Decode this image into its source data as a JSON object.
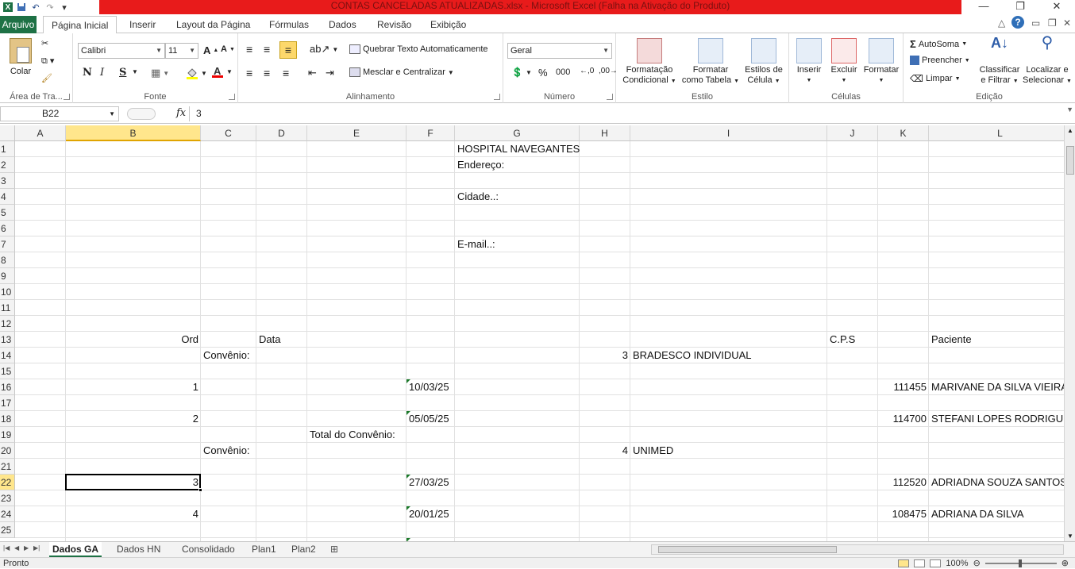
{
  "title_bar": {
    "title": "CONTAS CANCELADAS ATUALIZADAS.xlsx  -  Microsoft Excel (Falha na Ativação do Produto)",
    "icons": [
      "save-icon",
      "undo-icon",
      "redo-icon"
    ]
  },
  "ribbon_tabs": {
    "file": "Arquivo",
    "tabs": [
      "Página Inicial",
      "Inserir",
      "Layout da Página",
      "Fórmulas",
      "Dados",
      "Revisão",
      "Exibição"
    ],
    "active": "Página Inicial"
  },
  "ribbon": {
    "clipboard": {
      "paste": "Colar",
      "label": "Área de Tra..."
    },
    "font": {
      "name": "Calibri",
      "size": "11",
      "bold": "N",
      "italic": "I",
      "underline": "S",
      "label": "Fonte"
    },
    "alignment": {
      "wrap": "Quebrar Texto Automaticamente",
      "merge": "Mesclar e Centralizar",
      "label": "Alinhamento"
    },
    "number": {
      "format": "Geral",
      "percent": "%",
      "thousands": "000",
      "label": "Número"
    },
    "styles": {
      "conditional": [
        "Formatação",
        "Condicional"
      ],
      "table": [
        "Formatar",
        "como Tabela"
      ],
      "cell": [
        "Estilos de",
        "Célula"
      ],
      "label": "Estilo"
    },
    "cells": {
      "insert": "Inserir",
      "delete": "Excluir",
      "format": "Formatar",
      "label": "Células"
    },
    "editing": {
      "autosum": "AutoSoma",
      "fill": "Preencher",
      "clear": "Limpar",
      "sort": [
        "Classificar",
        "e Filtrar"
      ],
      "find": [
        "Localizar e",
        "Selecionar"
      ],
      "label": "Edição"
    }
  },
  "formula_bar": {
    "name_box": "B22",
    "fx": "fx",
    "formula": "3"
  },
  "columns": [
    "A",
    "B",
    "C",
    "D",
    "E",
    "F",
    "G",
    "H",
    "I",
    "J",
    "K",
    "L"
  ],
  "rows": [
    "1",
    "2",
    "3",
    "4",
    "5",
    "6",
    "7",
    "8",
    "9",
    "10",
    "11",
    "12",
    "13",
    "14",
    "15",
    "16",
    "17",
    "18",
    "19",
    "20",
    "21",
    "22",
    "23",
    "24",
    "25"
  ],
  "cells": {
    "G1": "HOSPITAL NAVEGANTES",
    "G2": "Endereço:",
    "G4": "Cidade..:",
    "G7": "E-mail..:",
    "B13": "Ord",
    "D13": "Data",
    "J13": "C.P.S",
    "L13": "Paciente",
    "C14": "Convênio:",
    "H14": "3",
    "I14": "BRADESCO INDIVIDUAL",
    "B16": "1",
    "F16": "10/03/25",
    "K16": "111455",
    "L16": "MARIVANE DA SILVA VIEIRA",
    "B18": "2",
    "F18": "05/05/25",
    "K18": "114700",
    "L18": "STEFANI LOPES RODRIGUES",
    "E19": "Total do Convênio:",
    "C20": "Convênio:",
    "H20": "4",
    "I20": "UNIMED",
    "B22": "3",
    "F22": "27/03/25",
    "K22": "112520",
    "L22": "ADRIADNA SOUZA SANTOS",
    "B24": "4",
    "F24": "20/01/25",
    "K24": "108475",
    "L24": "ADRIANA DA SILVA"
  },
  "sheets": [
    "Dados GA",
    "Dados HN",
    "Consolidado",
    "Plan1",
    "Plan2"
  ],
  "active_sheet": "Dados GA",
  "status": {
    "ready": "Pronto",
    "zoom": "100%"
  },
  "colors": {
    "title_red": "#e81b1b",
    "file_green": "#1e7145",
    "selection": "#ffe68c"
  }
}
